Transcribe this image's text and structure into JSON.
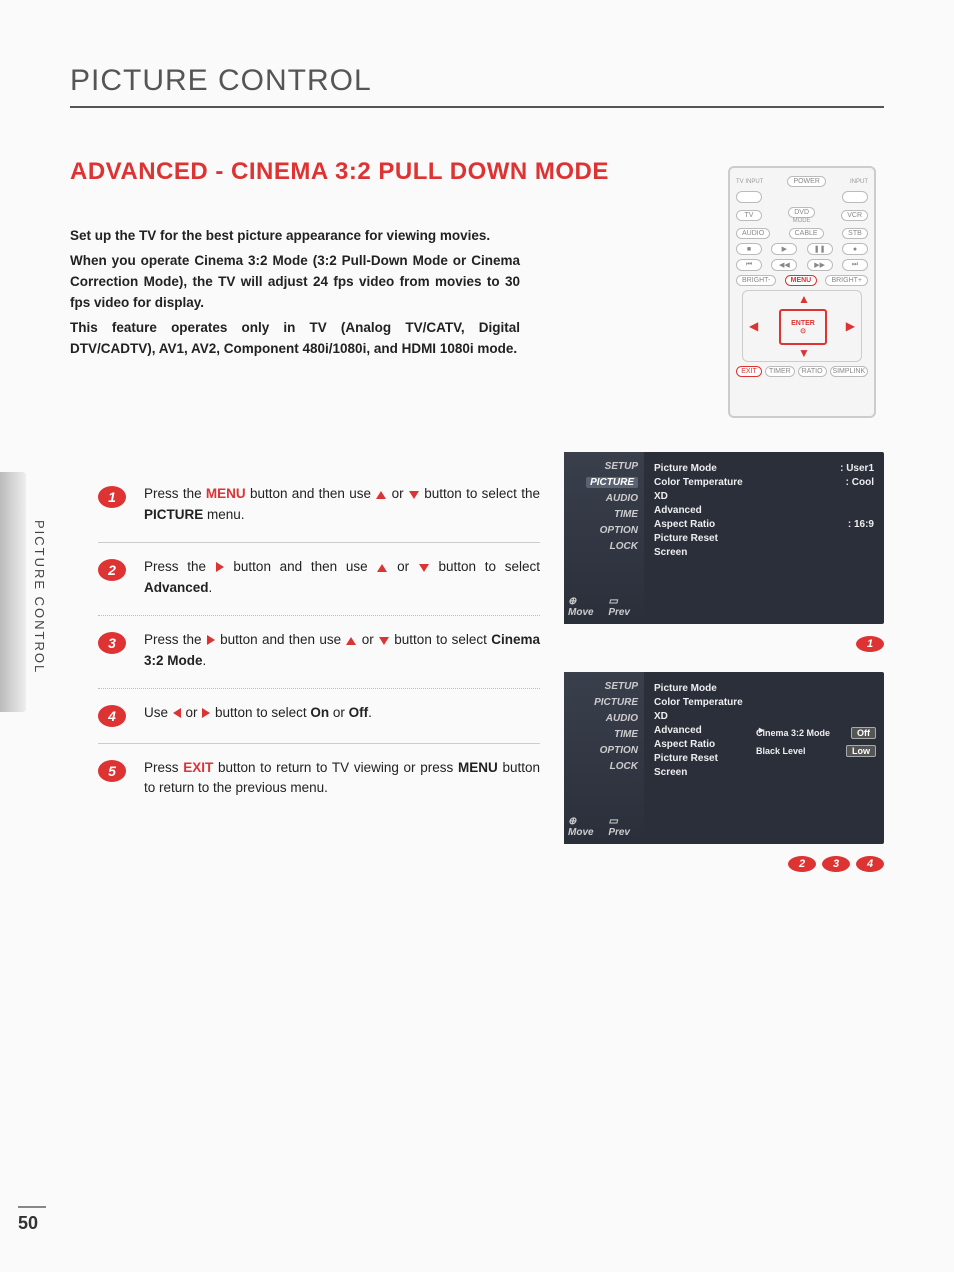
{
  "page": {
    "title": "PICTURE CONTROL",
    "section_title": "ADVANCED - CINEMA 3:2 PULL DOWN MODE",
    "side_tab": "PICTURE CONTROL",
    "number": "50"
  },
  "intro": {
    "p1": "Set up the TV for the best picture appearance for viewing movies.",
    "p2": "When you operate Cinema 3:2 Mode (3:2 Pull-Down Mode or Cinema Correction Mode), the TV will adjust 24 fps video from movies to 30 fps video for display.",
    "p3": "This feature operates only in TV (Analog TV/CATV, Digital DTV/CADTV), AV1, AV2, Component 480i/1080i, and HDMI 1080i mode."
  },
  "steps": {
    "s1_a": "Press the ",
    "s1_menu": "MENU",
    "s1_b": " button and then use ",
    "s1_c": " or ",
    "s1_d": " button to select the ",
    "s1_pic": "PICTURE",
    "s1_e": " menu.",
    "s2_a": "Press the ",
    "s2_b": " button and then use ",
    "s2_c": " or ",
    "s2_d": " button to select ",
    "s2_adv": "Advanced",
    "s2_e": ".",
    "s3_a": "Press the ",
    "s3_b": " button and then use ",
    "s3_c": " or ",
    "s3_d": " button to select ",
    "s3_cm": "Cinema 3:2 Mode",
    "s3_e": ".",
    "s4_a": "Use ",
    "s4_b": " or ",
    "s4_c": " button to select ",
    "s4_on": "On",
    "s4_d": " or ",
    "s4_off": "Off",
    "s4_e": ".",
    "s5_a": "Press ",
    "s5_exit": "EXIT",
    "s5_b": " button to return to TV viewing or press ",
    "s5_menu": "MENU",
    "s5_c": " button to return to the previous menu."
  },
  "refs": {
    "r1": "1",
    "r2": "2",
    "r3": "3",
    "r4": "4"
  },
  "remote": {
    "tv_input": "TV INPUT",
    "input": "INPUT",
    "power": "POWER",
    "tv": "TV",
    "dvd": "DVD",
    "vcr": "VCR",
    "mode": "MODE",
    "audio": "AUDIO",
    "cable": "CABLE",
    "stb": "STB",
    "bright_minus": "BRIGHT-",
    "menu": "MENU",
    "bright_plus": "BRIGHT+",
    "enter": "ENTER",
    "exit": "EXIT",
    "timer": "TIMER",
    "ratio": "RATIO",
    "simplink": "SIMPLINK"
  },
  "osd": {
    "side": {
      "setup": "SETUP",
      "picture": "PICTURE",
      "audio": "AUDIO",
      "time": "TIME",
      "option": "OPTION",
      "lock": "LOCK"
    },
    "foot_move": "Move",
    "foot_prev": "Prev",
    "menu1": {
      "picture_mode": "Picture Mode",
      "picture_mode_val": ": User1",
      "color_temp": "Color Temperature",
      "color_temp_val": ": Cool",
      "xd": "XD",
      "advanced": "Advanced",
      "aspect": "Aspect Ratio",
      "aspect_val": ": 16:9",
      "picture_reset": "Picture Reset",
      "screen": "Screen"
    },
    "menu2": {
      "picture_mode": "Picture Mode",
      "color_temp": "Color Temperature",
      "xd": "XD",
      "advanced": "Advanced",
      "aspect": "Aspect Ratio",
      "picture_reset": "Picture Reset",
      "screen": "Screen",
      "sub_cinema": "Cinema 3:2 Mode",
      "sub_cinema_val": "Off",
      "sub_black": "Black Level",
      "sub_black_val": "Low"
    }
  }
}
